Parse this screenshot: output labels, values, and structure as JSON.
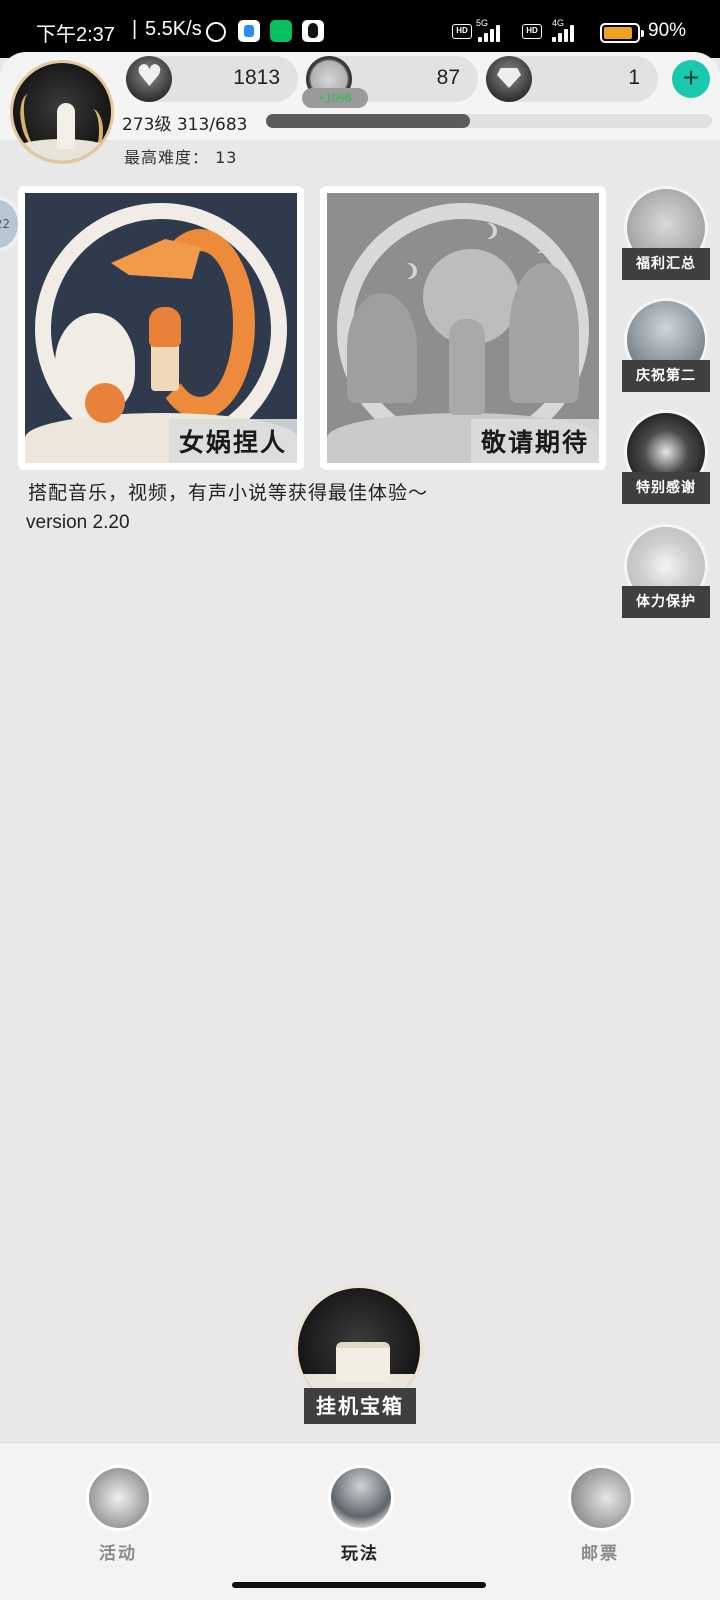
{
  "status_bar": {
    "time": "下午2:37",
    "separator": "|",
    "net_speed": "5.5K/s",
    "hd1": "HD",
    "net1": "5G",
    "hd2": "HD",
    "net2": "4G",
    "battery_percent": "90%",
    "battery_level": 0.9,
    "icons": [
      "alarm-icon",
      "app-notification-icon",
      "wechat-icon",
      "qq-icon",
      "signal-icon",
      "battery-icon"
    ]
  },
  "header": {
    "hearts": "1813",
    "coins": "87",
    "coin_tag": "+1096",
    "diamonds": "1",
    "add_label": "+",
    "level_text": "273级  313/683",
    "xp_current": 313,
    "xp_max": 683,
    "difficulty_text": "最高难度： 13",
    "side_tab_label": "22"
  },
  "cards": [
    {
      "label": "女娲捏人"
    },
    {
      "label": "敬请期待"
    }
  ],
  "tagline": "搭配音乐，视频，有声小说等获得最佳体验～",
  "version": "version 2.20",
  "side_menu": [
    {
      "label": "福利汇总"
    },
    {
      "label": "庆祝第二"
    },
    {
      "label": "特别感谢"
    },
    {
      "label": "体力保护"
    }
  ],
  "chest_label": "挂机宝箱",
  "bottom_nav": [
    {
      "label": "活动",
      "active": false
    },
    {
      "label": "玩法",
      "active": true
    },
    {
      "label": "邮票",
      "active": false
    }
  ],
  "colors": {
    "accent": "#19c9ae",
    "background": "#e8e8e8",
    "label_bg": "#3f3f3f",
    "battery": "#f0a020"
  }
}
